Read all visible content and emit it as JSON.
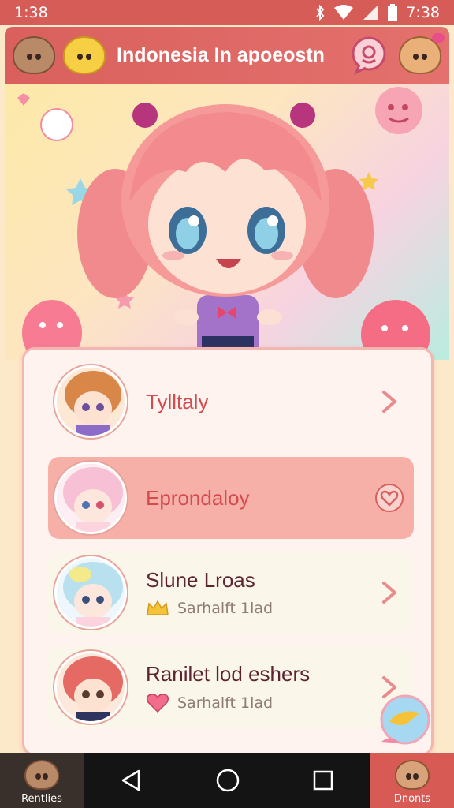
{
  "status": {
    "time_left": "1:38",
    "time_right": "7:38"
  },
  "app": {
    "title": "Indonesia In apoeostn"
  },
  "icons": {
    "left_mascots": [
      "bear-icon",
      "yellow-bear-icon"
    ],
    "right": [
      "chat-smiley-icon",
      "bear-bow-icon"
    ]
  },
  "list": {
    "items": [
      {
        "name": "Tylltaly",
        "subtitle": "",
        "action_icon": "chevron-right-icon"
      },
      {
        "name": "Eprondaloy",
        "subtitle": "",
        "action_icon": "heart-outline-icon"
      },
      {
        "name": "Slune Lroas",
        "subtitle": "Sarhalft 1lad",
        "badge_icon": "crown-icon",
        "action_icon": "chevron-right-icon"
      },
      {
        "name": "Ranilet lod eshers",
        "subtitle": "Sarhalft 1lad",
        "badge_icon": "heart-icon",
        "action_icon": "chevron-right-icon"
      }
    ]
  },
  "nav": {
    "left_label": "Rentlies",
    "right_label": "Dnonts"
  },
  "colors": {
    "accent": "#d9605d",
    "selected_row": "#f7b0a8",
    "panel": "#fff3f0"
  }
}
